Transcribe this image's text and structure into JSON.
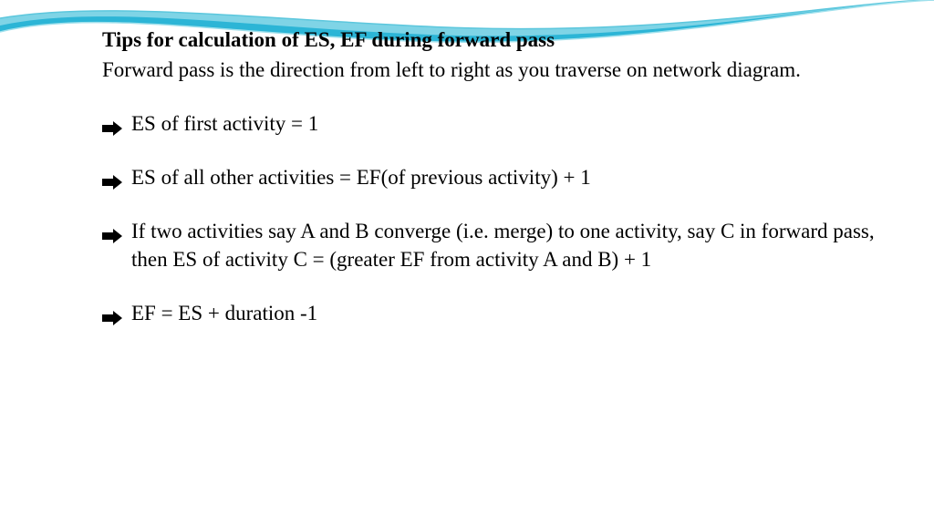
{
  "slide": {
    "title": "Tips for calculation of ES, EF during forward pass",
    "intro": "Forward pass is the direction from left to right as you traverse on network diagram.",
    "bullets": [
      "ES of first activity = 1",
      "ES of all other activities = EF(of previous activity) + 1",
      "If two activities say A and B converge (i.e. merge) to one activity, say C in forward pass, then ES of activity C = (greater EF from activity A and B) + 1",
      "EF = ES + duration -1"
    ]
  },
  "theme": {
    "swoosh_outer": "#2cb5d6",
    "swoosh_inner": "#ffffff",
    "swoosh_stroke": "#8fd9e8"
  }
}
